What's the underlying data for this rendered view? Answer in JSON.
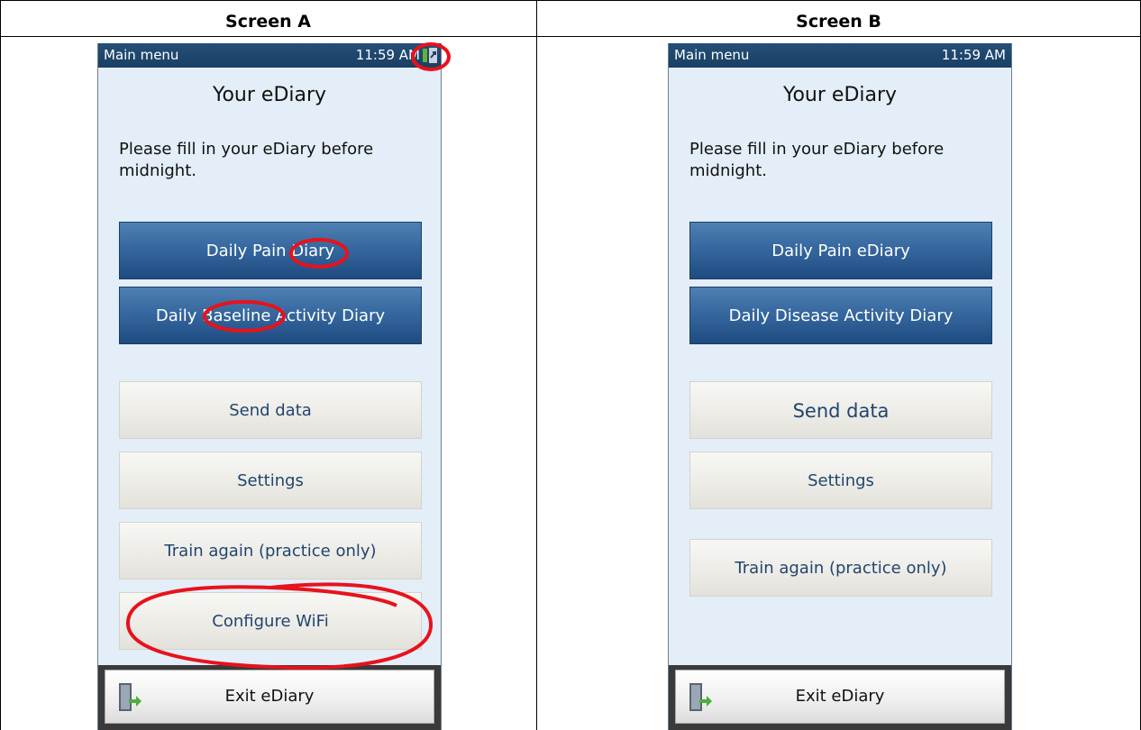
{
  "headers": {
    "a": "Screen A",
    "b": "Screen B"
  },
  "screen_a": {
    "status_label": "Main menu",
    "time": "11:59 AM",
    "title": "Your eDiary",
    "message": "Please fill in your eDiary before midnight.",
    "buttons": {
      "pain_diary": "Daily Pain Diary",
      "activity_diary": "Daily Baseline Activity Diary",
      "send_data": "Send data",
      "settings": "Settings",
      "train_again": "Train again (practice only)",
      "configure_wifi": "Configure WiFi"
    },
    "exit": "Exit eDiary"
  },
  "screen_b": {
    "status_label": "Main menu",
    "time": "11:59 AM",
    "title": "Your eDiary",
    "message": "Please fill in your eDiary before midnight.",
    "buttons": {
      "pain_diary": "Daily Pain eDiary",
      "activity_diary": "Daily Disease Activity Diary",
      "send_data": "Send data",
      "settings": "Settings",
      "train_again": "Train again (practice only)"
    },
    "exit": "Exit eDiary"
  },
  "icons": {
    "sync": "sync-status-icon",
    "exit": "exit-door-icon"
  },
  "colors": {
    "statusbar": "#1f466e",
    "primary_button": "#2f5f94",
    "annotation": "#e8121c",
    "background": "#e3eef8"
  }
}
